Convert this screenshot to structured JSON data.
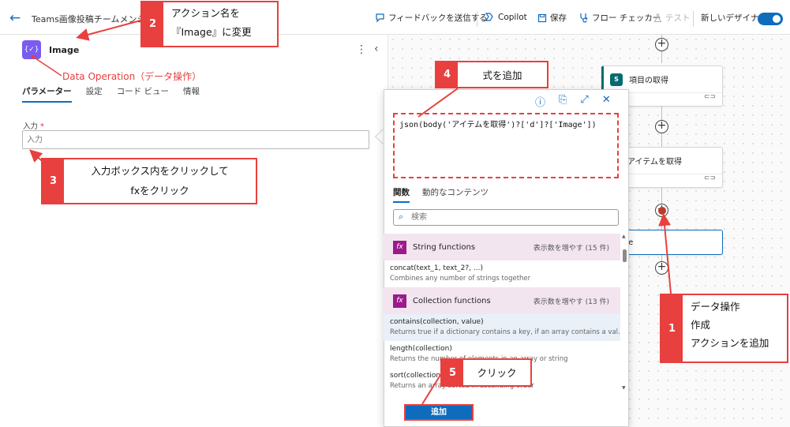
{
  "header": {
    "flow_title": "Teams画像投稿チームメンション",
    "feedback": "フィードバックを送信する",
    "copilot": "Copilot",
    "save": "保存",
    "flow_checker": "フロー チェッカー",
    "test": "テスト",
    "new_designer": "新しいデザイナー"
  },
  "panel": {
    "action_name": "Image",
    "tabs": [
      "パラメーター",
      "設定",
      "コード ビュー",
      "情報"
    ],
    "input_label": "入力",
    "input_required": "*",
    "input_placeholder": "入力"
  },
  "canvas": {
    "cards": [
      {
        "label": "項目の取得"
      },
      {
        "label": "アイテムを取得"
      },
      {
        "label": "Image"
      }
    ]
  },
  "popup": {
    "expression": "json(body('アイテムを取得')?['d']?['Image'])",
    "tabs": [
      "関数",
      "動的なコンテンツ"
    ],
    "search_placeholder": "検索",
    "groups": [
      {
        "name": "String functions",
        "more": "表示数を増やす (15 件)"
      },
      {
        "name": "Collection functions",
        "more": "表示数を増やす (13 件)"
      }
    ],
    "functions": [
      {
        "name": "concat(text_1, text_2?, ...)",
        "desc": "Combines any number of strings together"
      },
      {
        "name": "contains(collection, value)",
        "desc": "Returns true if a dictionary contains a key, if an array contains a val..."
      },
      {
        "name": "length(collection)",
        "desc": "Returns the number of elements in an array or string"
      },
      {
        "name": "sort(collection)",
        "desc": "Returns an array sorted in ascending order"
      }
    ],
    "add_button": "追加"
  },
  "annotations": {
    "data_operation": "Data Operation（データ操作）",
    "callouts": [
      {
        "num": "1",
        "lines": [
          "データ操作",
          "作成",
          "アクションを追加"
        ]
      },
      {
        "num": "2",
        "lines": [
          "アクション名を",
          "『Image』に変更"
        ]
      },
      {
        "num": "3",
        "lines": [
          "入力ボックス内をクリックして",
          "fxをクリック"
        ]
      },
      {
        "num": "4",
        "lines": [
          "式を追加"
        ]
      },
      {
        "num": "5",
        "lines": [
          "クリック"
        ]
      }
    ]
  },
  "colors": {
    "accent": "#0f6cbd",
    "annotation_red": "#e8403e",
    "sharepoint": "#036c70",
    "data_operation_icon": "#7a5cf0",
    "function_icon": "#9b1b8c"
  }
}
